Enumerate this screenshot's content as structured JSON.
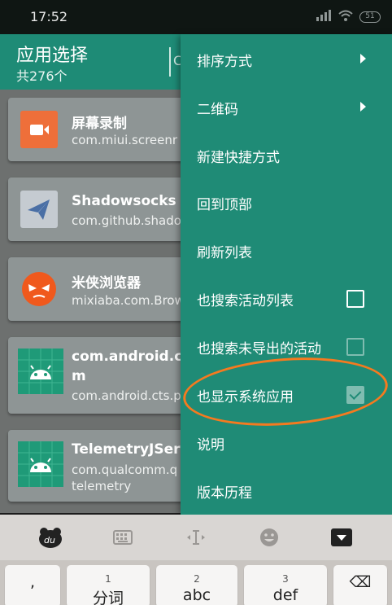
{
  "status_bar": {
    "time": "17:52",
    "signal": "☷̷",
    "battery": "51"
  },
  "app_bar": {
    "title": "应用选择",
    "subtitle": "共276个",
    "search_hint": "C"
  },
  "apps": [
    {
      "name": "屏幕录制",
      "package": "com.miui.screenr",
      "icon": "screen-recorder-icon",
      "color": "#ee6f3a"
    },
    {
      "name": "Shadowsocks",
      "package": "com.github.shado",
      "icon": "paper-plane-icon",
      "color": "#c5cbd1"
    },
    {
      "name": "米侠浏览器",
      "package": "mixiaba.com.Brow",
      "icon": "angry-face-icon",
      "color": "#f0591d"
    },
    {
      "name": "com.android.ct",
      "name_line2": "m",
      "package": "com.android.cts.p",
      "icon": "android-icon",
      "color": "#1f9a78"
    },
    {
      "name": "TelemetryJServ",
      "package": "com.qualcomm.q",
      "package_line2": "telemetry",
      "icon": "android-icon",
      "color": "#1f9a78"
    }
  ],
  "menu": [
    {
      "label": "排序方式",
      "kind": "submenu"
    },
    {
      "label": "二维码",
      "kind": "submenu"
    },
    {
      "label": "新建快捷方式",
      "kind": "item"
    },
    {
      "label": "回到顶部",
      "kind": "item"
    },
    {
      "label": "刷新列表",
      "kind": "item"
    },
    {
      "label": "也搜索活动列表",
      "kind": "checkbox",
      "checked": false,
      "enabled": true
    },
    {
      "label": "也搜索未导出的活动",
      "kind": "checkbox",
      "checked": false,
      "enabled": false
    },
    {
      "label": "也显示系统应用",
      "kind": "checkbox",
      "checked": true,
      "enabled": false
    },
    {
      "label": "说明",
      "kind": "item"
    },
    {
      "label": "版本历程",
      "kind": "item"
    }
  ],
  "keyboard": {
    "toolbar": [
      "du-logo-icon",
      "keyboard-icon",
      "cursor-icon",
      "emoji-icon",
      "hide-keyboard-icon"
    ],
    "keys": [
      {
        "num": "",
        "label": ","
      },
      {
        "num": "1",
        "label": "分词"
      },
      {
        "num": "2",
        "label": "abc"
      },
      {
        "num": "3",
        "label": "def"
      },
      {
        "num": "",
        "label": "⌫"
      }
    ]
  },
  "colors": {
    "primary": "#1e8b76",
    "annotation": "#f57a1f",
    "check_dim": "#7fbcb0"
  }
}
